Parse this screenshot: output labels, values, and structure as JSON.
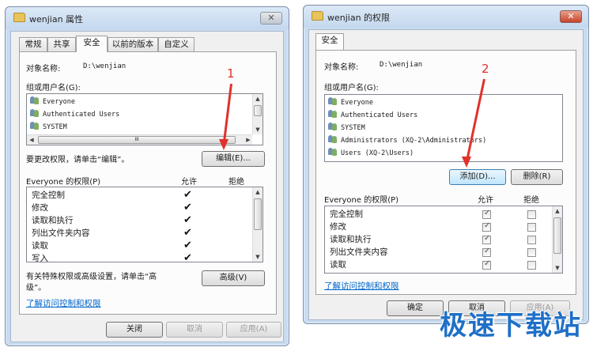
{
  "left_window": {
    "title": "wenjian 属性",
    "close_glyph": "✕",
    "tabs": [
      "常规",
      "共享",
      "安全",
      "以前的版本",
      "自定义"
    ],
    "selected_tab": "安全",
    "object_name_label": "对象名称:",
    "object_name_value": "D:\\wenjian",
    "groups_label": "组或用户名(G):",
    "users": [
      "Everyone",
      "Authenticated Users",
      "SYSTEM"
    ],
    "change_perm_text": "要更改权限，请单击“编辑”。",
    "edit_button": "编辑(E)...",
    "perm_header": "Everyone 的权限(P)",
    "allow_col": "允许",
    "deny_col": "拒绝",
    "permissions": [
      {
        "name": "完全控制",
        "allow": true,
        "deny": false
      },
      {
        "name": "修改",
        "allow": true,
        "deny": false
      },
      {
        "name": "读取和执行",
        "allow": true,
        "deny": false
      },
      {
        "name": "列出文件夹内容",
        "allow": true,
        "deny": false
      },
      {
        "name": "读取",
        "allow": true,
        "deny": false
      },
      {
        "name": "写入",
        "allow": true,
        "deny": false
      }
    ],
    "special_text_line1": "有关特殊权限或高级设置，请单击“高",
    "special_text_line2": "级”。",
    "advanced_button": "高级(V)",
    "learn_link": "了解访问控制和权限",
    "close_button": "关闭",
    "cancel_button": "取消",
    "apply_button": "应用(A)",
    "hscroll_grip": "III"
  },
  "right_window": {
    "title": "wenjian 的权限",
    "close_glyph": "✕",
    "tab": "安全",
    "object_name_label": "对象名称:",
    "object_name_value": "D:\\wenjian",
    "groups_label": "组或用户名(G):",
    "users": [
      "Everyone",
      "Authenticated Users",
      "SYSTEM",
      "Administrators (XQ-2\\Administrators)",
      "Users (XQ-2\\Users)"
    ],
    "add_button": "添加(D)...",
    "remove_button": "删除(R)",
    "perm_header": "Everyone 的权限(P)",
    "allow_col": "允许",
    "deny_col": "拒绝",
    "permissions": [
      {
        "name": "完全控制",
        "allow": true,
        "deny": false
      },
      {
        "name": "修改",
        "allow": true,
        "deny": false
      },
      {
        "name": "读取和执行",
        "allow": true,
        "deny": false
      },
      {
        "name": "列出文件夹内容",
        "allow": true,
        "deny": false
      },
      {
        "name": "读取",
        "allow": true,
        "deny": false
      }
    ],
    "learn_link": "了解访问控制和权限",
    "ok_button": "确定",
    "cancel_button": "取消",
    "apply_button": "应用(A)"
  },
  "annotations": {
    "step1": "1",
    "step2": "2",
    "color": "#e0312b"
  },
  "watermark": "极速下载站",
  "colors": {
    "title_bar": "#c8dbf0",
    "link": "#0066cc",
    "watermark": "#1e6fc7"
  }
}
